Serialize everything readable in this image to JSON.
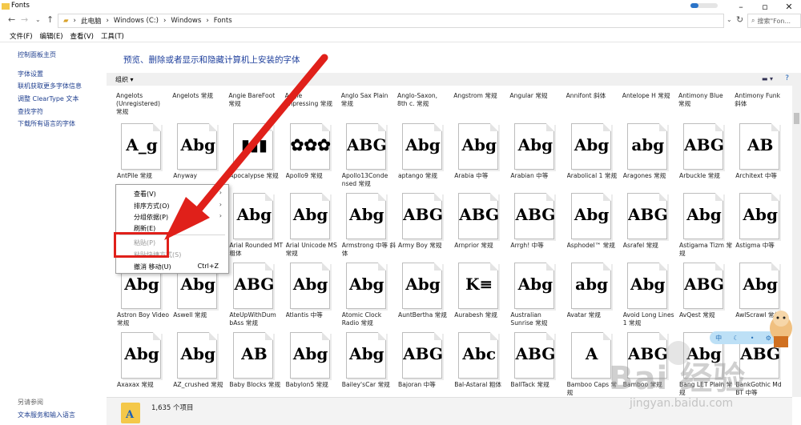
{
  "window": {
    "title": "Fonts"
  },
  "address": {
    "parts": [
      "此电脑",
      "Windows (C:)",
      "Windows",
      "Fonts"
    ],
    "search_placeholder": "搜索\"Fon..."
  },
  "menubar": [
    "文件(F)",
    "编辑(E)",
    "查看(V)",
    "工具(T)"
  ],
  "leftpane": {
    "top_links": [
      "控制面板主页",
      "字体设置",
      "联机获取更多字体信息",
      "调整 ClearType 文本",
      "查找字符",
      "下载所有语言的字体"
    ],
    "see_also_title": "另请参阅",
    "see_also_link": "文本服务和输入语言"
  },
  "main": {
    "headline": "预览、删除或者显示和隐藏计算机上安装的字体",
    "organize": "组织 ▾",
    "top_captions": [
      "Angelots\n(Unregistered)\n常规",
      "Angelots 常规",
      "Angie BareFoot\n常规",
      "Angie\nImpressing 常规",
      "Anglo Sax Plain\n常规",
      "Anglo-Saxon,\n8th c. 常规",
      "Angstrom 常规",
      "Angular 常规",
      "Annifont 斜体",
      "Antelope H 常规",
      "Antimony Blue\n常规",
      "Antimony Funk\n斜体"
    ],
    "rows": [
      [
        {
          "glyph": "A_g",
          "name": "AntPile 常规"
        },
        {
          "glyph": "Abg",
          "name": "Anyway"
        },
        {
          "glyph": "▮▮▮",
          "name": "Apocalypse 常规"
        },
        {
          "glyph": "✿✿✿",
          "name": "Apollo9 常规"
        },
        {
          "glyph": "ABG",
          "name": "Apollo13Conde nsed 常规"
        },
        {
          "glyph": "Abg",
          "name": "aptango 常规"
        },
        {
          "glyph": "Abg",
          "name": "Arabia 中等"
        },
        {
          "glyph": "Abg",
          "name": "Arabian 中等"
        },
        {
          "glyph": "Abg",
          "name": "Arabolical 1 常规"
        },
        {
          "glyph": "abg",
          "name": "Aragones 常规"
        },
        {
          "glyph": "ABG",
          "name": "Arbuckle 常规"
        },
        {
          "glyph": "AB",
          "name": "Architext 中等"
        }
      ],
      [
        {
          "glyph": "",
          "name": ""
        },
        {
          "glyph": "",
          "name": ""
        },
        {
          "glyph": "Abg",
          "name": "Arial Rounded MT 粗体"
        },
        {
          "glyph": "Abg",
          "name": "Arial Unicode MS 常规"
        },
        {
          "glyph": "Abg",
          "name": "Armstrong 中等 斜体"
        },
        {
          "glyph": "ABG",
          "name": "Army Boy 常规"
        },
        {
          "glyph": "ABG",
          "name": "Arnprior 常规"
        },
        {
          "glyph": "ABG",
          "name": "Arrgh! 中等"
        },
        {
          "glyph": "Abg",
          "name": "Asphodel™ 常规"
        },
        {
          "glyph": "ABG",
          "name": "Asrafel 常规"
        },
        {
          "glyph": "Abg",
          "name": "Astigama Tizm 常规"
        },
        {
          "glyph": "Abg",
          "name": "Astigma 中等"
        }
      ],
      [
        {
          "glyph": "Abg",
          "name": "Astron Boy Video 常规"
        },
        {
          "glyph": "Abg",
          "name": "Aswell 常规"
        },
        {
          "glyph": "ABG",
          "name": "AteUpWithDum bAss 常规"
        },
        {
          "glyph": "Abg",
          "name": "Atlantis 中等"
        },
        {
          "glyph": "Abg",
          "name": "Atomic Clock Radio 常规"
        },
        {
          "glyph": "Abg",
          "name": "AuntBertha 常规"
        },
        {
          "glyph": "K≡",
          "name": "Aurabesh 常规"
        },
        {
          "glyph": "Abg",
          "name": "Australian Sunrise 常规"
        },
        {
          "glyph": "abg",
          "name": "Avatar 常规"
        },
        {
          "glyph": "Abg",
          "name": "Avoid Long Lines 1 常规"
        },
        {
          "glyph": "ABG",
          "name": "AvQest 常规"
        },
        {
          "glyph": "Abg",
          "name": "AwlScrawl 常规"
        }
      ],
      [
        {
          "glyph": "Abg",
          "name": "Axaxax 常规"
        },
        {
          "glyph": "Abg",
          "name": "AZ_crushed 常规"
        },
        {
          "glyph": "AB",
          "name": "Baby Blocks 常规"
        },
        {
          "glyph": "Abg",
          "name": "Babylon5 常规"
        },
        {
          "glyph": "Abg",
          "name": "Bailey'sCar 常规"
        },
        {
          "glyph": "ABG",
          "name": "Bajoran 中等"
        },
        {
          "glyph": "Abc",
          "name": "Bal-Astaral 粗体"
        },
        {
          "glyph": "ABG",
          "name": "BallTack 常规"
        },
        {
          "glyph": "A",
          "name": "Bamboo Caps 常规"
        },
        {
          "glyph": "ABG",
          "name": "Bamboo 常规"
        },
        {
          "glyph": "Abg",
          "name": "Bang LET Plain 常规"
        },
        {
          "glyph": "ABG",
          "name": "BankGothic Md BT 中等"
        }
      ]
    ]
  },
  "status": {
    "count": "1,635 个项目"
  },
  "context_menu": {
    "view": "查看(V)",
    "sort": "排序方式(O)",
    "group": "分组依据(P)",
    "refresh": "刷新(E)",
    "paste": "粘贴(P)",
    "paste_shortcut": "粘贴快捷方式(S)",
    "undo": "撤消 移动(U)",
    "undo_key": "Ctrl+Z"
  },
  "watermark": {
    "brand": "Bai 经验",
    "url": "jingyan.baidu.com"
  },
  "colors": {
    "arrow": "#e0201a",
    "link": "#1f3f8f",
    "headline": "#1e3f9c"
  }
}
